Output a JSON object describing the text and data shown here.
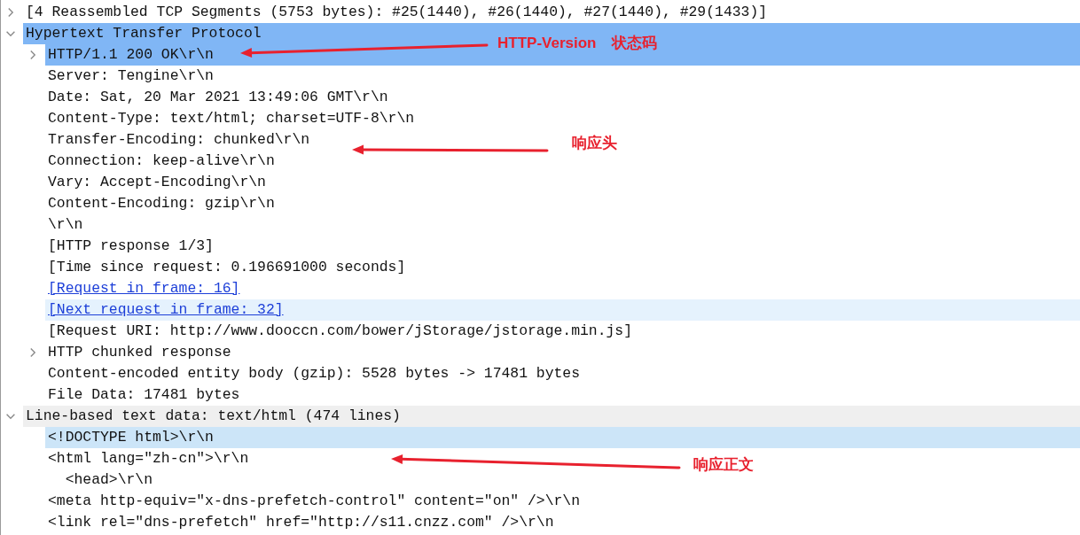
{
  "tree": [
    {
      "text": "[4 Reassembled TCP Segments (5753 bytes): #25(1440), #26(1440), #27(1440), #29(1433)]",
      "kind": "field",
      "selected": false,
      "shaded": false,
      "expanded": false
    },
    {
      "text": "Hypertext Transfer Protocol",
      "kind": "field",
      "selected": true,
      "shaded": false,
      "expanded": true,
      "children": [
        {
          "text": "HTTP/1.1 200 OK\\r\\n",
          "kind": "field",
          "selected": true,
          "hovered": false,
          "expanded": false
        },
        {
          "text": "Server: Tengine\\r\\n",
          "kind": "field",
          "selected": false,
          "hovered": false
        },
        {
          "text": "Date: Sat, 20 Mar 2021 13:49:06 GMT\\r\\n",
          "kind": "field",
          "selected": false,
          "hovered": false
        },
        {
          "text": "Content-Type: text/html; charset=UTF-8\\r\\n",
          "kind": "field",
          "selected": false,
          "hovered": false
        },
        {
          "text": "Transfer-Encoding: chunked\\r\\n",
          "kind": "field",
          "selected": false,
          "hovered": false
        },
        {
          "text": "Connection: keep-alive\\r\\n",
          "kind": "field",
          "selected": false,
          "hovered": false
        },
        {
          "text": "Vary: Accept-Encoding\\r\\n",
          "kind": "field",
          "selected": false,
          "hovered": false
        },
        {
          "text": "Content-Encoding: gzip\\r\\n",
          "kind": "field",
          "selected": false,
          "hovered": false
        },
        {
          "text": "\\r\\n",
          "kind": "field",
          "selected": false,
          "hovered": false
        },
        {
          "text": "[HTTP response 1/3]",
          "kind": "field",
          "selected": false,
          "hovered": false
        },
        {
          "text": "[Time since request: 0.196691000 seconds]",
          "kind": "field",
          "selected": false,
          "hovered": false
        },
        {
          "text": "[Request in frame: 16]",
          "kind": "link",
          "selected": false,
          "hovered": false
        },
        {
          "text": "[Next request in frame: 32]",
          "kind": "link",
          "selected": false,
          "hovered": true
        },
        {
          "text": "[Request URI: http://www.dooccn.com/bower/jStorage/jstorage.min.js]",
          "kind": "field",
          "selected": false,
          "hovered": false
        },
        {
          "text": "HTTP chunked response",
          "kind": "field",
          "selected": false,
          "hovered": false,
          "expanded": false
        },
        {
          "text": "Content-encoded entity body (gzip): 5528 bytes -> 17481 bytes",
          "kind": "field",
          "selected": false,
          "hovered": false
        },
        {
          "text": "File Data: 17481 bytes",
          "kind": "field",
          "selected": false,
          "hovered": false
        }
      ]
    },
    {
      "text": "Line-based text data: text/html (474 lines)",
      "kind": "field",
      "selected": false,
      "shaded": true,
      "expanded": true,
      "children": [
        {
          "text": "<!DOCTYPE html>\\r\\n",
          "kind": "field",
          "selected": false,
          "highlighted": true
        },
        {
          "text": "<html lang=\"zh-cn\">\\r\\n",
          "kind": "field",
          "selected": false,
          "highlighted": false
        },
        {
          "text": "  <head>\\r\\n",
          "kind": "field",
          "selected": false,
          "highlighted": false
        },
        {
          "text": "<meta http-equiv=\"x-dns-prefetch-control\" content=\"on\" />\\r\\n",
          "kind": "field",
          "selected": false,
          "highlighted": false
        },
        {
          "text": "<link rel=\"dns-prefetch\" href=\"http://s11.cnzz.com\" />\\r\\n",
          "kind": "field",
          "selected": false,
          "highlighted": false
        }
      ]
    }
  ],
  "annotations": [
    {
      "labels": [
        "HTTP-Version",
        "状态码"
      ]
    },
    {
      "labels": [
        "响应头"
      ]
    },
    {
      "labels": [
        "响应正文"
      ]
    }
  ]
}
